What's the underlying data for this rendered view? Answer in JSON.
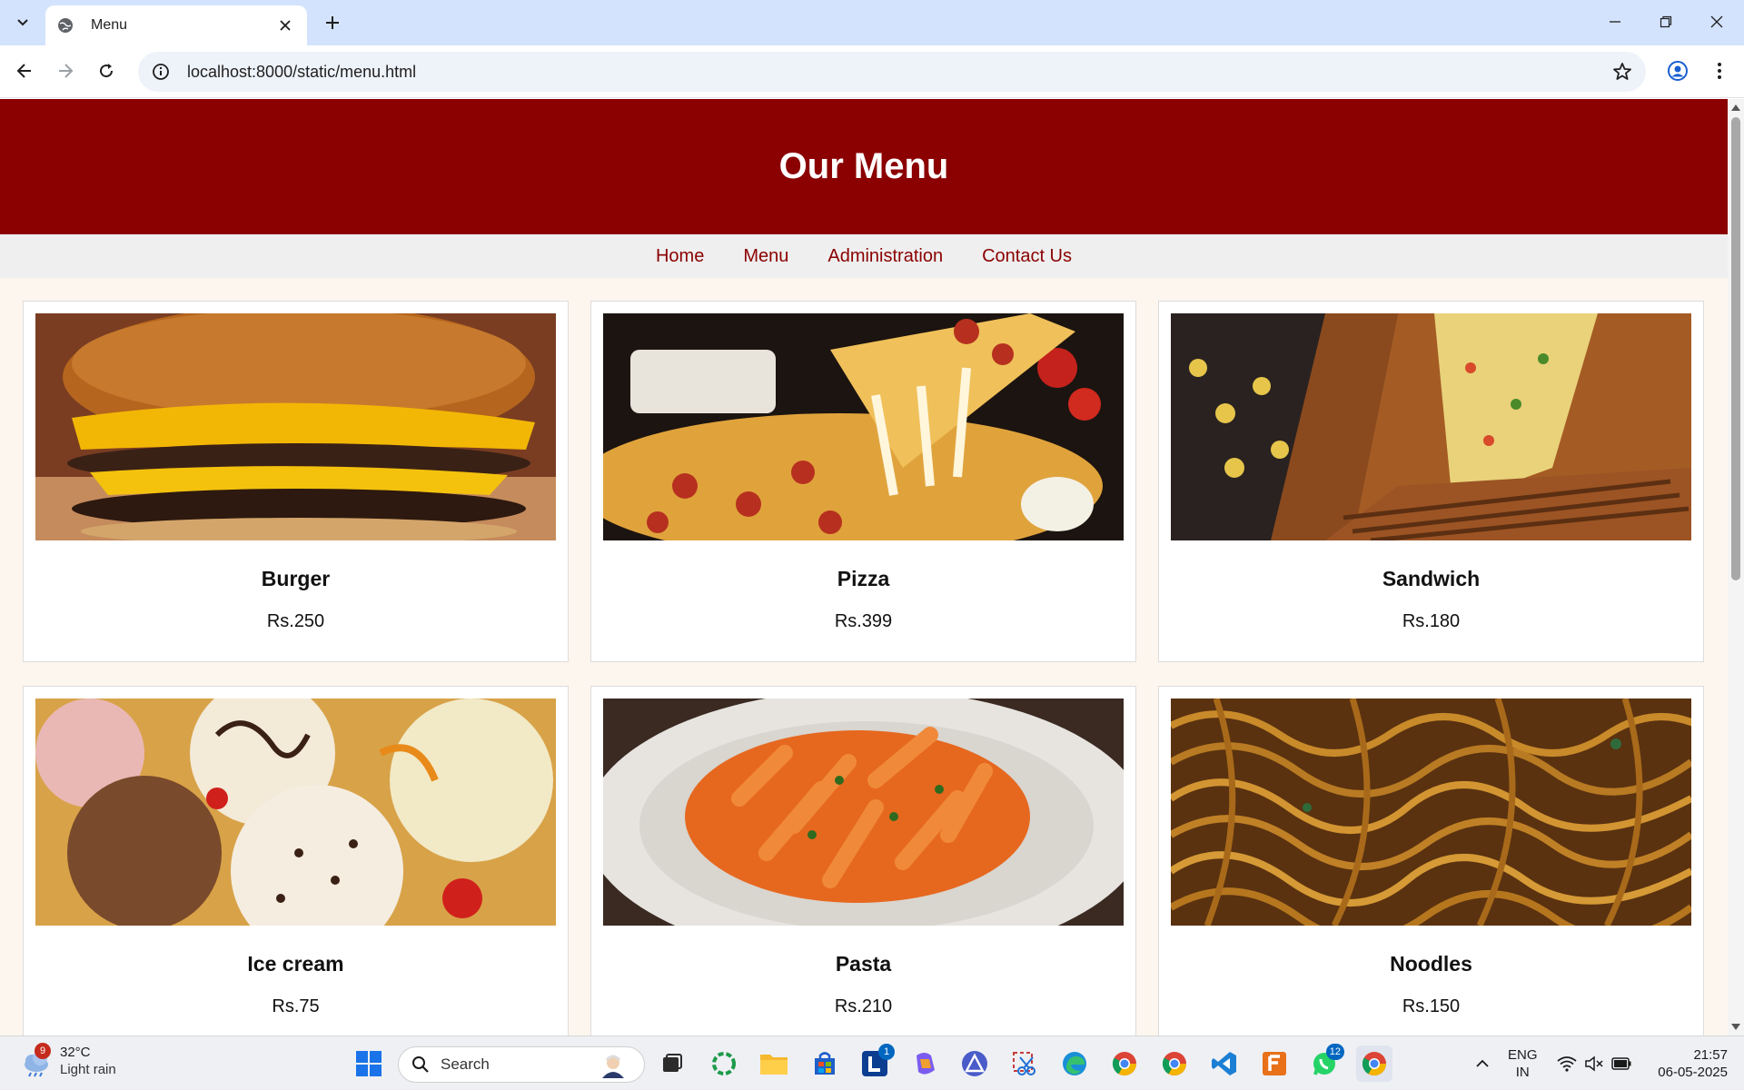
{
  "browser": {
    "tab_title": "Menu",
    "url": "localhost:8000/static/menu.html"
  },
  "page": {
    "header_title": "Our Menu",
    "nav": [
      {
        "label": "Home"
      },
      {
        "label": "Menu"
      },
      {
        "label": "Administration"
      },
      {
        "label": "Contact Us"
      }
    ],
    "items": [
      {
        "name": "Burger",
        "price": "Rs.250"
      },
      {
        "name": "Pizza",
        "price": "Rs.399"
      },
      {
        "name": "Sandwich",
        "price": "Rs.180"
      },
      {
        "name": "Ice cream",
        "price": "Rs.75"
      },
      {
        "name": "Pasta",
        "price": "Rs.210"
      },
      {
        "name": "Noodles",
        "price": "Rs.150"
      }
    ]
  },
  "taskbar": {
    "weather_temp": "32°C",
    "weather_condition": "Light rain",
    "weather_badge": "9",
    "search_label": "Search",
    "outlook_badge": "1",
    "whatsapp_badge": "12",
    "lang_line1": "ENG",
    "lang_line2": "IN",
    "time": "21:57",
    "date": "06-05-2025"
  },
  "colors": {
    "header_bg": "#8b0000",
    "nav_link": "#8b0000",
    "page_bg": "#fdf6ee"
  }
}
